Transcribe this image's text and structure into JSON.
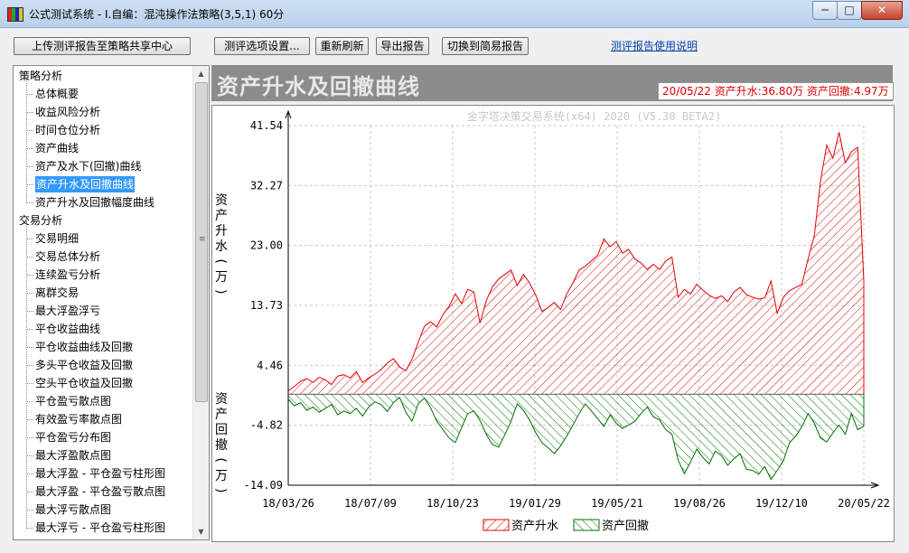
{
  "window": {
    "title": "公式测试系统 - I.自编：混沌操作法策略(3,5,1) 60分",
    "controls": [
      "minimize",
      "maximize",
      "close"
    ]
  },
  "toolbar": {
    "upload_label": "上传测评报告至策略共享中心",
    "options_label": "测评选项设置...",
    "refresh_label": "重新刷新",
    "export_label": "导出报告",
    "simple_label": "切换到简易报告",
    "help_link": "测评报告使用说明"
  },
  "tree": {
    "groups": [
      {
        "label": "策略分析",
        "children": [
          "总体概要",
          "收益风险分析",
          "时间仓位分析",
          "资产曲线",
          "资产及水下(回撤)曲线",
          "资产升水及回撤曲线",
          "资产升水及回撤幅度曲线"
        ]
      },
      {
        "label": "交易分析",
        "children": [
          "交易明细",
          "交易总体分析",
          "连续盈亏分析",
          "离群交易",
          "最大浮盈浮亏",
          "平仓收益曲线",
          "平仓收益曲线及回撤",
          "多头平仓收益及回撤",
          "空头平仓收益及回撤",
          "平仓盈亏散点图",
          "有效盈亏率散点图",
          "平仓盈亏分布图",
          "最大浮盈散点图",
          "最大浮盈 - 平仓盈亏柱形图",
          "最大浮盈 - 平仓盈亏散点图",
          "最大浮亏散点图",
          "最大浮亏 - 平仓盈亏柱形图"
        ]
      }
    ],
    "selected": "资产升水及回撤曲线"
  },
  "chart_header": {
    "title": "资产升水及回撤曲线",
    "info": "20/05/22 资产升水:36.80万  资产回撤:4.97万"
  },
  "chart_data": {
    "type": "area",
    "watermark": "金字塔决策交易系统(x64) 2020 (V5.30 BETA2)",
    "ylabel_upper": "资产升水(万)",
    "ylabel_lower": "资产回撤(万)",
    "y_ticks": [
      "41.54",
      "32.27",
      "23.00",
      "13.73",
      "4.46",
      "-4.82",
      "-14.09"
    ],
    "ylim": [
      -14.09,
      41.54
    ],
    "x_ticks": [
      "18/03/26",
      "18/07/09",
      "18/10/23",
      "19/01/29",
      "19/05/21",
      "19/08/26",
      "19/12/10",
      "20/05/22"
    ],
    "grid": true,
    "legend_position": "bottom-center",
    "series": [
      {
        "name": "资产升水",
        "color": "#e00000",
        "values": [
          0.5,
          1.2,
          2.0,
          2.4,
          1.8,
          2.6,
          2.2,
          1.5,
          2.8,
          3.0,
          2.5,
          3.5,
          1.8,
          2.5,
          3.1,
          3.8,
          4.8,
          5.5,
          4.2,
          3.6,
          5.4,
          8.0,
          10.5,
          11.2,
          10.4,
          12.3,
          13.6,
          15.5,
          14.0,
          16.2,
          15.8,
          11.0,
          14.5,
          16.6,
          17.8,
          18.5,
          19.2,
          16.8,
          18.5,
          17.2,
          15.3,
          12.8,
          13.4,
          14.2,
          13.1,
          15.5,
          17.2,
          19.2,
          19.8,
          20.6,
          21.5,
          24.0,
          22.8,
          23.6,
          21.8,
          22.4,
          20.9,
          20.3,
          19.3,
          20.1,
          19.3,
          20.6,
          21.2,
          15.0,
          16.2,
          15.5,
          17.0,
          16.1,
          15.3,
          14.8,
          15.2,
          14.3,
          15.8,
          16.5,
          15.4,
          15.0,
          14.7,
          14.9,
          17.5,
          12.5,
          15.0,
          16.0,
          16.5,
          17.0,
          21.0,
          24.5,
          33.0,
          38.5,
          36.5,
          40.5,
          35.8,
          37.5,
          38.2,
          17.5
        ]
      },
      {
        "name": "资产回撤",
        "color": "#007000",
        "values": [
          -0.8,
          -1.8,
          -1.3,
          -2.5,
          -2.0,
          -2.8,
          -2.2,
          -1.6,
          -3.2,
          -2.6,
          -3.0,
          -2.2,
          -3.4,
          -2.0,
          -1.2,
          -1.6,
          -2.7,
          -1.3,
          -0.5,
          -2.8,
          -4.2,
          -1.5,
          -0.6,
          -2.1,
          -4.2,
          -5.5,
          -6.8,
          -7.5,
          -5.2,
          -3.0,
          -2.6,
          -4.1,
          -6.2,
          -7.8,
          -8.2,
          -6.3,
          -4.2,
          -1.5,
          -2.5,
          -4.0,
          -6.0,
          -7.5,
          -8.3,
          -9.2,
          -8.0,
          -6.5,
          -4.8,
          -3.0,
          -1.5,
          -2.6,
          -3.8,
          -5.0,
          -3.2,
          -4.5,
          -5.3,
          -4.8,
          -4.2,
          -3.0,
          -2.0,
          -3.5,
          -4.0,
          -5.5,
          -6.2,
          -10.2,
          -12.3,
          -10.5,
          -8.5,
          -9.8,
          -10.8,
          -8.8,
          -9.5,
          -11.0,
          -10.0,
          -9.2,
          -11.6,
          -11.8,
          -12.4,
          -11.2,
          -13.2,
          -11.8,
          -10.3,
          -7.5,
          -6.5,
          -5.0,
          -3.0,
          -4.5,
          -6.8,
          -7.4,
          -6.0,
          -4.8,
          -6.2,
          -3.0,
          -5.5,
          -4.97
        ]
      }
    ]
  }
}
